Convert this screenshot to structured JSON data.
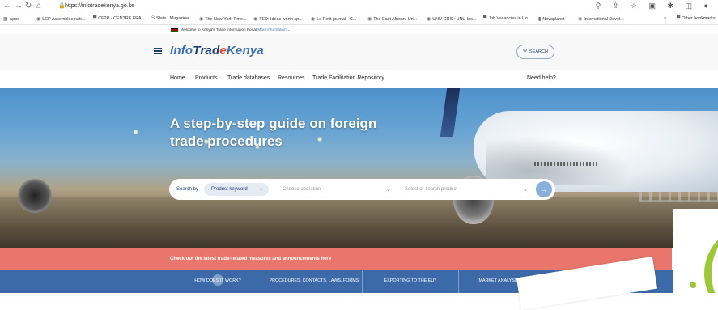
{
  "browser": {
    "url": "https://infotradekenya.go.ke",
    "bookmarks": [
      "Apps",
      "LCP Assemblée nati...",
      "CF2R - CENTRE FRA...",
      "Slate | Magazine",
      "The New York Time...",
      "TED: Ideas worth sp...",
      "Le Petit journal - C...",
      "The East African: Un...",
      "UNU-CRIS: UNU Ins...",
      "Job Vacancies in Un...",
      "Novaplanet",
      "International Devel...",
      "»",
      "Other bookmarks"
    ]
  },
  "notice": {
    "text": "Welcome to Kenya's Trade Information Portal",
    "more": "More information"
  },
  "header": {
    "logo_info": "Info",
    "logo_trade": "Trad",
    "logo_e": "e",
    "logo_kenya": "Kenya",
    "search_label": "SEARCH"
  },
  "nav": [
    "Home",
    "Products",
    "Trade databases",
    "Resources",
    "Trade Facilitation Repository"
  ],
  "nav_help": "Need help?",
  "hero": {
    "title": "A step-by-step guide on foreign trade procedures"
  },
  "search": {
    "label": "Search by",
    "keyword": "Product keyword",
    "operation_placeholder": "Choose operation",
    "product_placeholder": "Select or search product"
  },
  "announcement": {
    "text": "Check out the latest trade-related measures and announcements",
    "link": "here"
  },
  "tabs": [
    "HOW DOES IT WORK?",
    "PROCEDURES, CONTACTS, LAWS, FORMS",
    "EXPORTING TO THE EU?",
    "MARKET ANALYSIS TOOLS"
  ]
}
